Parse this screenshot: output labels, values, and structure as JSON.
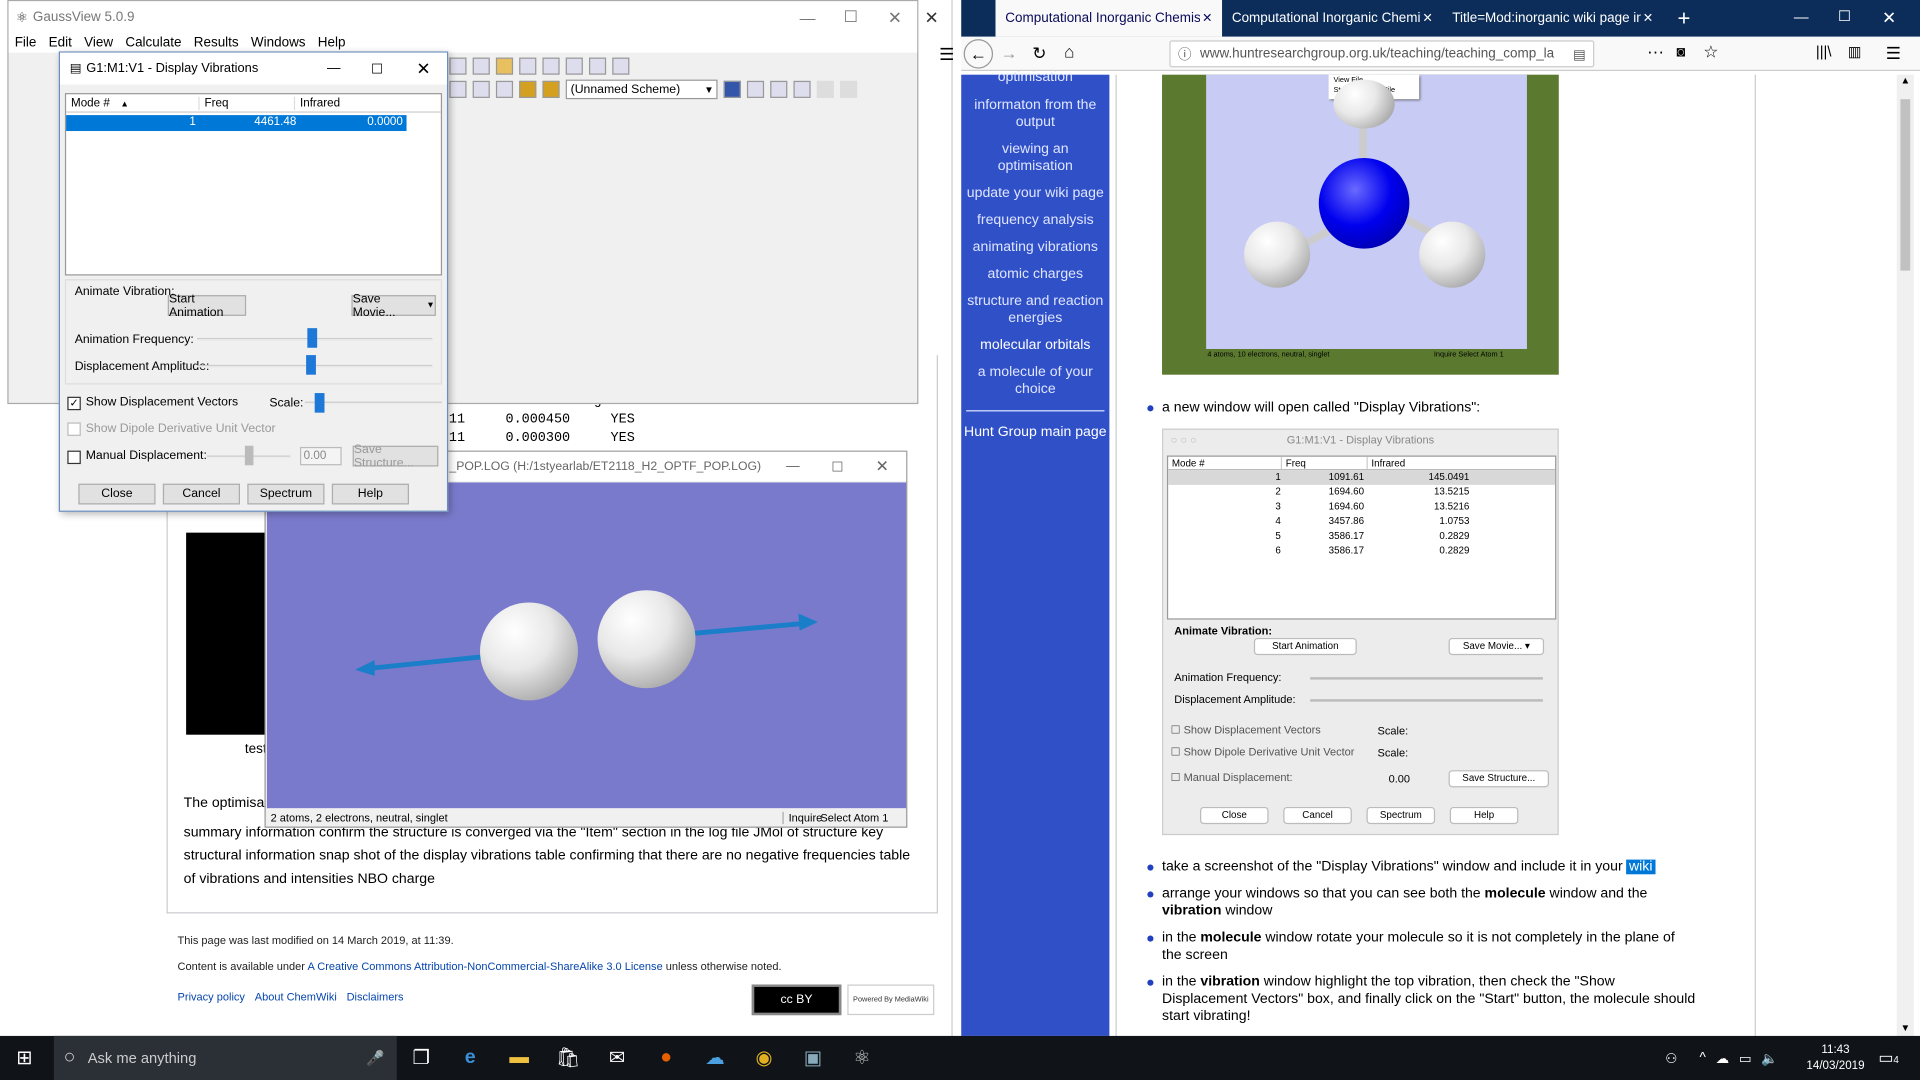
{
  "gaussview": {
    "title": "GaussView 5.0.9",
    "menu": [
      "File",
      "Edit",
      "View",
      "Calculate",
      "Results",
      "Windows",
      "Help"
    ],
    "scheme": "(Unnamed Scheme)",
    "log_text": {
      "l1": "ue    Threshold  Converged?",
      "l2": "211     0.000450     YES",
      "l3": "211     0.000300     YES"
    }
  },
  "dialog": {
    "title": "G1:M1:V1 - Display Vibrations",
    "columns": [
      "Mode #",
      "Freq",
      "Infrared"
    ],
    "row": {
      "mode": "1",
      "freq": "4461.48",
      "ir": "0.0000"
    },
    "animate_label": "Animate Vibration:",
    "start_label": "Start Animation",
    "save_movie": "Save Movie...",
    "anim_freq": "Animation Frequency:",
    "disp_amp": "Displacement Amplitude:",
    "show_disp": "Show Displacement Vectors",
    "scale": "Scale:",
    "show_dipole": "Show Dipole Derivative Unit Vector",
    "manual_disp": "Manual Displacement:",
    "manual_val": "0.00",
    "save_structure": "Save Structure...",
    "buttons": {
      "close": "Close",
      "cancel": "Cancel",
      "spectrum": "Spectrum",
      "help": "Help"
    }
  },
  "molwin": {
    "title": "_POP.LOG (H:/1styearlab/ET2118_H2_OPTF_POP.LOG)",
    "status": "2 atoms, 2 electrons, neutral, singlet",
    "inquire": "Inquire",
    "select": "Select Atom 1"
  },
  "wiki": {
    "caption_stub": "test",
    "para_start": "The optimisat",
    "para": [
      "summary information confirm the structure is converged via the \"Item\" section in the log file JMol of structure key",
      "structural information snap shot of the display vibrations table confirming that there are no negative frequencies table",
      "of vibrations and intensities NBO charge"
    ],
    "modified": "This page was last modified on 14 March 2019, at 11:39.",
    "content_pre": "Content is available under ",
    "license": "A Creative Commons Attribution-NonCommercial-ShareAlike 3.0 License",
    "content_post": " unless otherwise noted.",
    "links": [
      "Privacy policy",
      "About ChemWiki",
      "Disclaimers"
    ],
    "cc_badge": "cc BY",
    "mw_badge": "Powered By MediaWiki"
  },
  "firefox": {
    "tabs": [
      "Computational Inorganic Chemistry",
      "Computational Inorganic Chemistry",
      "Title=Mod:inorganic wiki page inst"
    ],
    "url": "www.huntresearchgroup.org.uk/teaching/teaching_comp_la",
    "sidebar": [
      "optimisation",
      "informaton from the output",
      "viewing an optimisation",
      "update your wiki page",
      "frequency analysis",
      "animating vibrations",
      "atomic charges",
      "structure and reaction energies",
      "molecular orbitals",
      "a molecule of your choice",
      "Hunt Group main page"
    ],
    "nh3_menu": [
      "View File",
      "Stream Output File"
    ],
    "nh3_status": "4 atoms, 10 electrons, neutral, singlet",
    "nh3_status_right": "Inquire Select Atom 1",
    "bullet1": "a new window will open called \"Display Vibrations\":",
    "mac_dialog": {
      "title": "G1:M1:V1 - Display Vibrations",
      "columns": [
        "Mode #",
        "Freq",
        "Infrared"
      ],
      "rows": [
        [
          "1",
          "1091.61",
          "145.0491"
        ],
        [
          "2",
          "1694.60",
          "13.5215"
        ],
        [
          "3",
          "1694.60",
          "13.5216"
        ],
        [
          "4",
          "3457.86",
          "1.0753"
        ],
        [
          "5",
          "3586.17",
          "0.2829"
        ],
        [
          "6",
          "3586.17",
          "0.2829"
        ]
      ],
      "animate": "Animate Vibration:",
      "start": "Start Animation",
      "save_movie": "Save Movie...",
      "anim_freq": "Animation Frequency:",
      "disp_amp": "Displacement Amplitude:",
      "show_disp": "Show Displacement Vectors",
      "show_dipole": "Show Dipole Derivative Unit Vector",
      "scale": "Scale:",
      "manual": "Manual Displacement:",
      "manual_val": "0.00",
      "save_structure": "Save Structure...",
      "buttons": [
        "Close",
        "Cancel",
        "Spectrum",
        "Help"
      ]
    },
    "b2_pre": "take a screenshot of the \"Display Vibrations\" window and include it in your ",
    "b2_hl": "wiki",
    "b3_a": "arrange your windows so that you can see both the ",
    "b3_b": "molecule",
    "b3_c": " window and the",
    "b3_d": "vibration",
    "b3_e": " window",
    "b4_a": "in the ",
    "b4_b": "molecule",
    "b4_c": " window rotate your molecule so it is not completely in the plane of",
    "b4_d": "the screen",
    "b5_a": "in the ",
    "b5_b": "vibration",
    "b5_c": " window highlight the top vibration, then check the \"Show",
    "b5_d": "Displacement Vectors\" box, and finally click on the \"Start\" button, the molecule should",
    "b5_e": "start vibrating!"
  },
  "taskbar": {
    "search": "Ask me anything",
    "time": "11:43",
    "date": "14/03/2019",
    "notif": "4"
  }
}
